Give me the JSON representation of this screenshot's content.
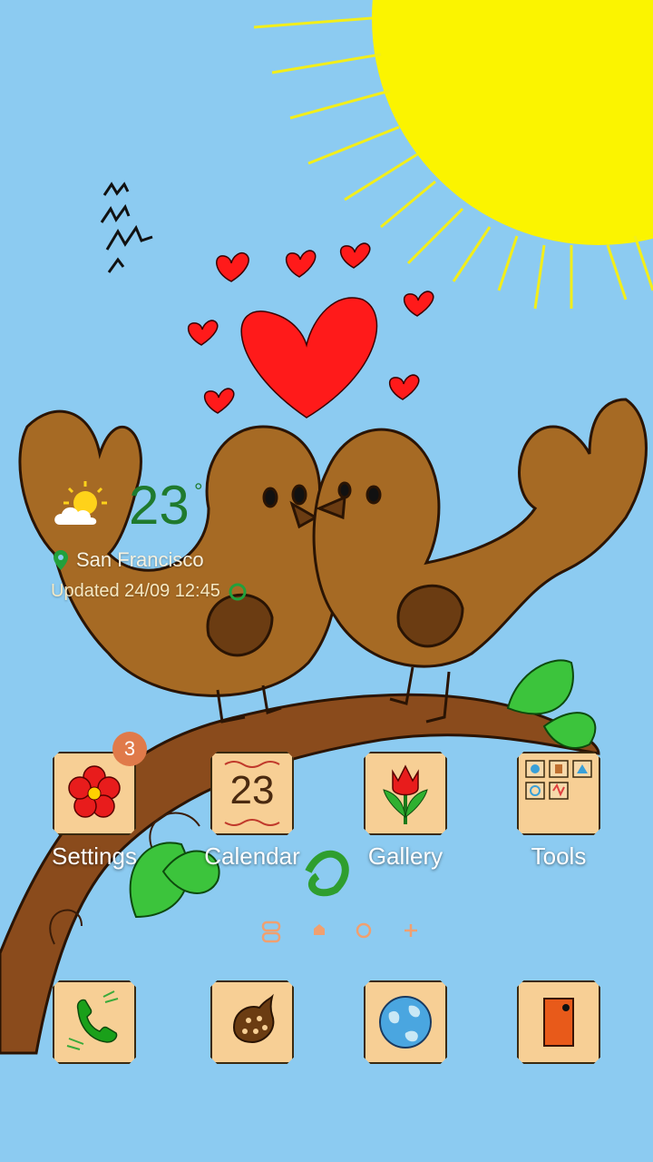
{
  "weather": {
    "temperature": "23",
    "unit": "°",
    "location": "San Francisco",
    "updated": "Updated 24/09 12:45",
    "icon": "partly-sunny-icon"
  },
  "apps": [
    {
      "label": "Settings",
      "icon": "flower-settings-icon",
      "badge": "3"
    },
    {
      "label": "Calendar",
      "icon": "calendar-icon",
      "date": "23"
    },
    {
      "label": "Gallery",
      "icon": "tulip-gallery-icon"
    },
    {
      "label": "Tools",
      "icon": "tools-folder-icon"
    }
  ],
  "dock": [
    {
      "icon": "phone-icon"
    },
    {
      "icon": "messages-icon"
    },
    {
      "icon": "globe-browser-icon"
    },
    {
      "icon": "camera-icon"
    }
  ],
  "page_indicator": {
    "icons": [
      "flipboard-page-icon",
      "home-page-icon",
      "page-dot-icon",
      "add-page-icon"
    ]
  },
  "colors": {
    "sky": "#8ccbf1",
    "sun": "#fbf400",
    "tile": "#f7cf95",
    "badge": "#e07a4a",
    "temp": "#1f7a2e"
  }
}
